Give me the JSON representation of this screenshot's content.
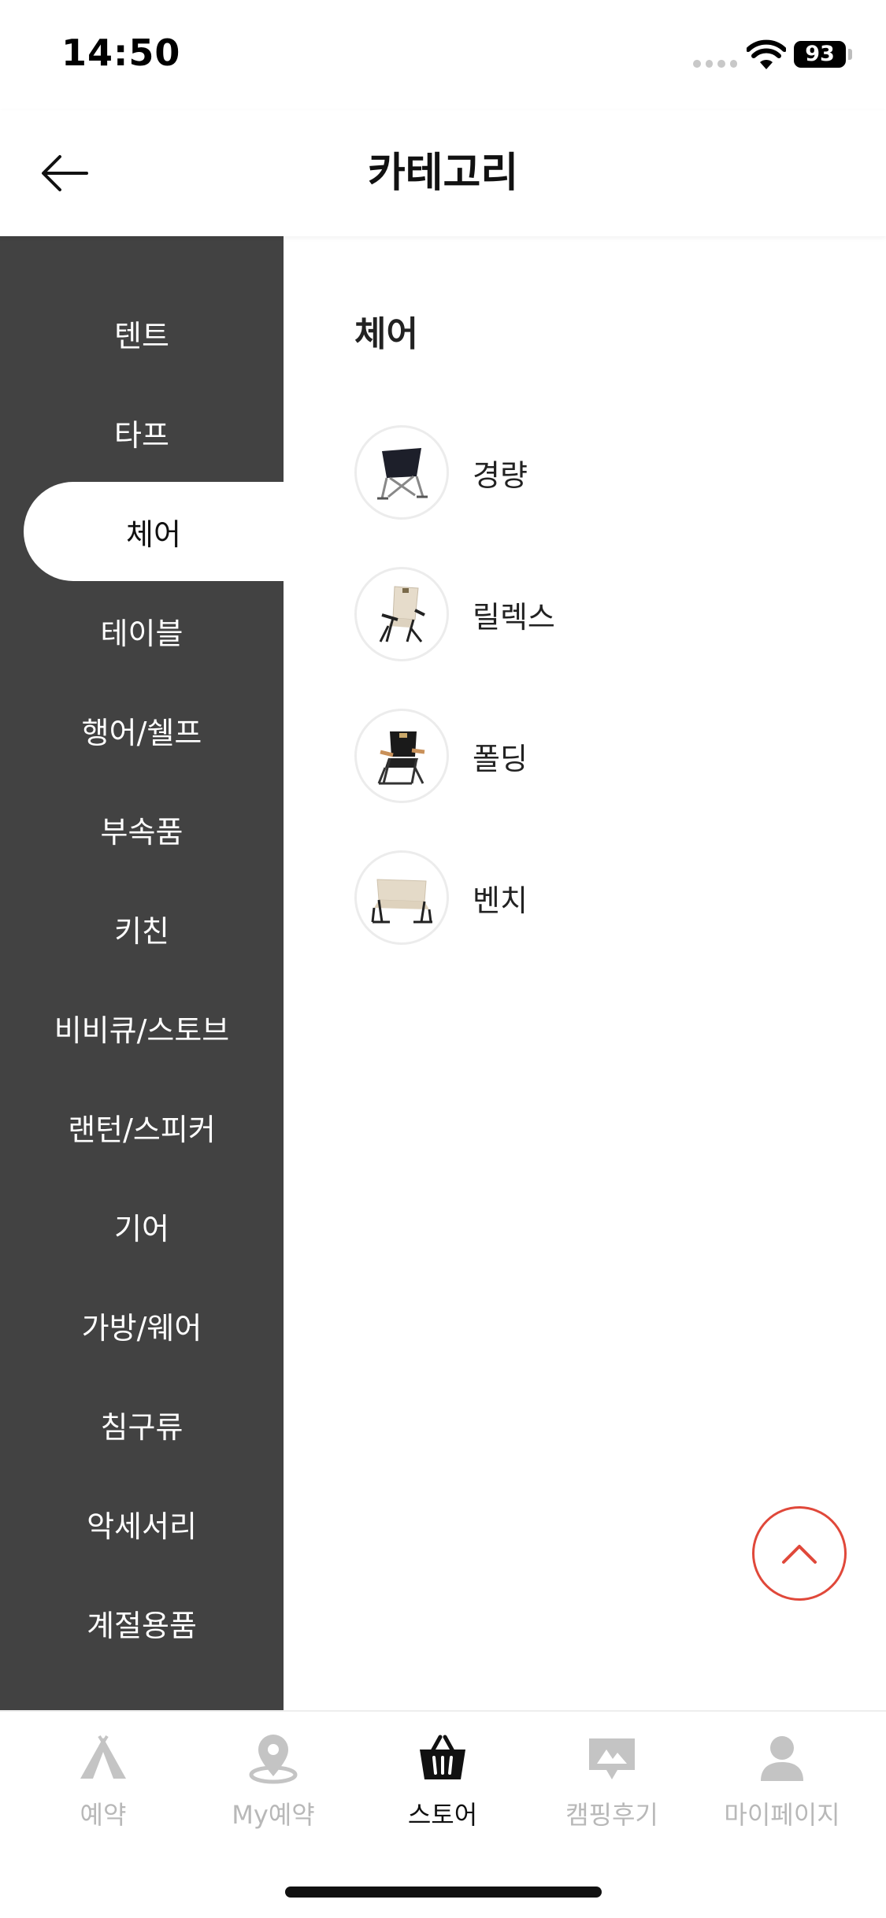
{
  "status_bar": {
    "time": "14:50",
    "battery": "93"
  },
  "header": {
    "title": "카테고리"
  },
  "sidebar": {
    "items": [
      {
        "label": "텐트"
      },
      {
        "label": "타프"
      },
      {
        "label": "체어",
        "active": true
      },
      {
        "label": "테이블"
      },
      {
        "label": "행어/쉘프"
      },
      {
        "label": "부속품"
      },
      {
        "label": "키친"
      },
      {
        "label": "비비큐/스토브"
      },
      {
        "label": "랜턴/스피커"
      },
      {
        "label": "기어"
      },
      {
        "label": "가방/웨어"
      },
      {
        "label": "침구류"
      },
      {
        "label": "악세서리"
      },
      {
        "label": "계절용품"
      }
    ]
  },
  "content": {
    "section_title": "체어",
    "items": [
      {
        "label": "경량",
        "icon": "lightweight-chair-icon"
      },
      {
        "label": "릴렉스",
        "icon": "relax-chair-icon"
      },
      {
        "label": "폴딩",
        "icon": "folding-chair-icon"
      },
      {
        "label": "벤치",
        "icon": "bench-icon"
      }
    ]
  },
  "tabbar": {
    "tabs": [
      {
        "label": "예약",
        "icon": "tent-icon"
      },
      {
        "label": "My예약",
        "icon": "location-pin-icon"
      },
      {
        "label": "스토어",
        "icon": "shopping-basket-icon",
        "active": true
      },
      {
        "label": "캠핑후기",
        "icon": "review-photo-icon"
      },
      {
        "label": "마이페이지",
        "icon": "user-icon"
      }
    ]
  },
  "colors": {
    "sidebar_bg": "#424242",
    "accent": "#e0483a",
    "inactive_tab": "#b8b8b8"
  }
}
